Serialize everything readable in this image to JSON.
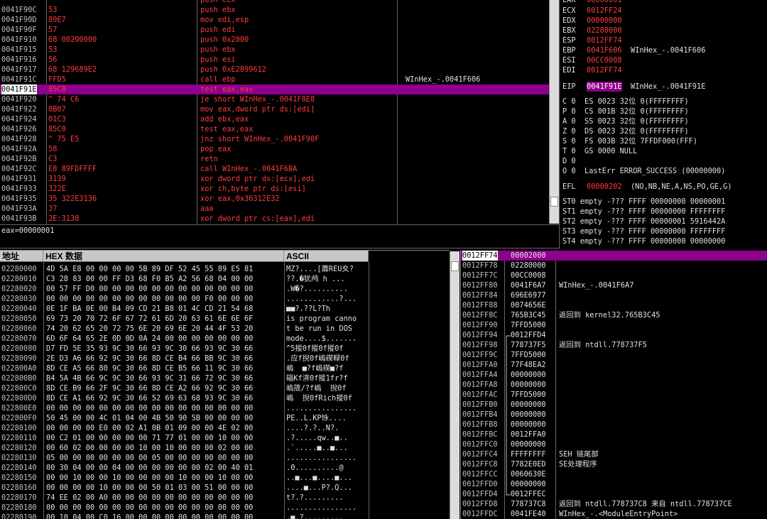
{
  "disasm": {
    "rows": [
      {
        "addr": "0041F90C",
        "bytes": "53",
        "instr": "push ebx",
        "comment": ""
      },
      {
        "addr": "0041F90D",
        "bytes": "89E7",
        "instr": "mov edi,esp",
        "comment": ""
      },
      {
        "addr": "0041F90F",
        "bytes": "57",
        "instr": "push edi",
        "comment": ""
      },
      {
        "addr": "0041F910",
        "bytes": "68 00200000",
        "instr": "push 0x2000",
        "comment": ""
      },
      {
        "addr": "0041F915",
        "bytes": "53",
        "instr": "push ebx",
        "comment": ""
      },
      {
        "addr": "0041F916",
        "bytes": "56",
        "instr": "push esi",
        "comment": ""
      },
      {
        "addr": "0041F917",
        "bytes": "68 129689E2",
        "instr": "push 0xE2899612",
        "comment": ""
      },
      {
        "addr": "0041F91C",
        "bytes": "FFD5",
        "instr": "call ebp",
        "comment": "WInHex_-.0041F606"
      },
      {
        "addr": "0041F91E",
        "bytes": "85C0",
        "instr": "test eax,eax",
        "comment": ""
      },
      {
        "addr": "0041F920",
        "bytes": "^ 74 C6",
        "instr": "je short WInHex_-.0041F8E8",
        "comment": ""
      },
      {
        "addr": "0041F922",
        "bytes": "8B07",
        "instr": "mov eax,dword ptr ds:[edi]",
        "comment": ""
      },
      {
        "addr": "0041F924",
        "bytes": "01C3",
        "instr": "add ebx,eax",
        "comment": ""
      },
      {
        "addr": "0041F926",
        "bytes": "85C0",
        "instr": "test eax,eax",
        "comment": ""
      },
      {
        "addr": "0041F928",
        "bytes": "^ 75 E5",
        "instr": "jnz short WInHex_-.0041F90F",
        "comment": ""
      },
      {
        "addr": "0041F92A",
        "bytes": "58",
        "instr": "pop eax",
        "comment": ""
      },
      {
        "addr": "0041F92B",
        "bytes": "C3",
        "instr": "retn",
        "comment": ""
      },
      {
        "addr": "0041F92C",
        "bytes": "E8 89FDFFFF",
        "instr": "call WInHex_-.0041F6BA",
        "comment": ""
      },
      {
        "addr": "0041F931",
        "bytes": "3139",
        "instr": "xor dword ptr ds:[ecx],edi",
        "comment": ""
      },
      {
        "addr": "0041F933",
        "bytes": "322E",
        "instr": "xor ch,byte ptr ds:[esi]",
        "comment": ""
      },
      {
        "addr": "0041F935",
        "bytes": "35 322E3136",
        "instr": "xor eax,0x36312E32",
        "comment": ""
      },
      {
        "addr": "0041F93A",
        "bytes": "37",
        "instr": "aaa",
        "comment": ""
      },
      {
        "addr": "0041F93B",
        "bytes": "2E:3138",
        "instr": "xor dword ptr cs:[eax],edi",
        "comment": ""
      }
    ],
    "selected_index": 8,
    "info_line": "eax=00000001"
  },
  "registers": {
    "lines": [
      {
        "name": "ECX",
        "value": "0012FF24",
        "note": ""
      },
      {
        "name": "EDX",
        "value": "00000000",
        "note": ""
      },
      {
        "name": "EBX",
        "value": "02280000",
        "note": ""
      },
      {
        "name": "ESP",
        "value": "0012FF74",
        "note": ""
      },
      {
        "name": "EBP",
        "value": "0041F606",
        "note": "WInHex_-.0041F606"
      },
      {
        "name": "ESI",
        "value": "00CC0008",
        "note": ""
      },
      {
        "name": "EDI",
        "value": "0012FF74",
        "note": ""
      }
    ],
    "eip": {
      "name": "EIP",
      "value": "0041F91E",
      "note": "WInHex_-.0041F91E"
    },
    "flags": [
      "C 0  ES 0023 32位 0(FFFFFFFF)",
      "P 0  CS 001B 32位 0(FFFFFFFF)",
      "A 0  SS 0023 32位 0(FFFFFFFF)",
      "Z 0  DS 0023 32位 0(FFFFFFFF)",
      "S 0  FS 003B 32位 7FFDF000(FFF)",
      "T 0  GS 0000 NULL",
      "D 0",
      "O 0  LastErr ERROR_SUCCESS (00000000)"
    ],
    "efl": {
      "name": "EFL",
      "value": "00000202",
      "note": "(NO,NB,NE,A,NS,PO,GE,G)"
    },
    "fpu": [
      "ST0 empty -??? FFFF 00000000 00000001",
      "ST1 empty -??? FFFF 00000000 FFFFFFFF",
      "ST2 empty -??? FFFF 00000001 5916442A",
      "ST3 empty -??? FFFF 00000000 FFFFFFFF",
      "ST4 empty -??? FFFF 00000000 00000000"
    ]
  },
  "dump": {
    "headers": {
      "address": "地址",
      "hex": "HEX 数据",
      "ascii": "ASCII"
    },
    "rows": [
      {
        "addr": "02280000",
        "hex": "4D 5A E8 00 00 00 00 5B 89 DF 52 45 55 89 E5 81",
        "ascii": "MZ?....[蕭REU夊?"
      },
      {
        "addr": "02280010",
        "hex": "C3 28 83 00 00 FF D3 68 F0 B5 A2 56 68 04 00 00",
        "ascii": "??.�犹鸬 h ..."
      },
      {
        "addr": "02280020",
        "hex": "00 57 FF D0 00 00 00 00 00 00 00 00 00 00 00 00",
        "ascii": ".W�?.........."
      },
      {
        "addr": "02280030",
        "hex": "00 00 00 00 00 00 00 00 00 00 00 00 F0 00 00 00",
        "ascii": "............?..."
      },
      {
        "addr": "02280040",
        "hex": "0E 1F BA 0E 00 B4 09 CD 21 B8 01 4C CD 21 54 68",
        "ascii": "■■?.??L?Th"
      },
      {
        "addr": "02280050",
        "hex": "69 73 20 70 72 6F 67 72 61 6D 20 63 61 6E 6E 6F",
        "ascii": "is program canno"
      },
      {
        "addr": "02280060",
        "hex": "74 20 62 65 20 72 75 6E 20 69 6E 20 44 4F 53 20",
        "ascii": "t be run in DOS "
      },
      {
        "addr": "02280070",
        "hex": "6D 6F 64 65 2E 0D 0D 0A 24 00 00 00 00 00 00 00",
        "ascii": "mode....$......."
      },
      {
        "addr": "02280080",
        "hex": "D7 FD 5E 35 93 9C 30 66 93 9C 30 66 93 9C 30 66",
        "ascii": "^5摐0f摐0f摐0f"
      },
      {
        "addr": "02280090",
        "hex": "2E D3 A6 66 92 9C 30 66 8D CE B4 66 BB 9C 30 66",
        "ascii": ".应f掜0f嵨碶粶0f"
      },
      {
        "addr": "022800A0",
        "hex": "8D CE A5 66 80 9C 30 66 8D CE B5 66 11 9C 30 66",
        "ascii": "嵨  ■?f嵨碶■?f"
      },
      {
        "addr": "022800B0",
        "hex": "B4 5A 4B 66 9C 9C 30 66 93 9C 31 66 72 9C 30 66",
        "ascii": "碯Kf渀0f摐1fr?f"
      },
      {
        "addr": "022800C0",
        "hex": "8D CE B9 66 2F 9C 30 66 8D CE A2 66 92 9C 30 66",
        "ascii": "嵨筬/?f嵨  掜0f"
      },
      {
        "addr": "022800D0",
        "hex": "8D CE A1 66 92 9C 30 66 52 69 63 68 93 9C 30 66",
        "ascii": "嵨  掜0fRich摐0f"
      },
      {
        "addr": "022800E0",
        "hex": "00 00 00 00 00 00 00 00 00 00 00 00 00 00 00 00",
        "ascii": "................"
      },
      {
        "addr": "022800F0",
        "hex": "50 45 00 00 4C 01 04 00 4B 50 90 5B 00 00 00 00",
        "ascii": "PE..L.KP怺...."
      },
      {
        "addr": "02280100",
        "hex": "00 00 00 00 E0 00 02 A1 0B 01 09 00 00 4E 02 00",
        "ascii": "....?.?..N?."
      },
      {
        "addr": "02280110",
        "hex": "00 C2 01 00 00 00 00 00 71 77 01 00 00 10 00 00",
        "ascii": ".?.....qw..■.."
      },
      {
        "addr": "02280120",
        "hex": "00 60 02 00 00 00 00 10 00 10 00 00 00 02 00 00",
        "ascii": ".`.....■..■..."
      },
      {
        "addr": "02280130",
        "hex": "05 00 00 00 00 00 00 00 05 00 00 00 00 00 00 00",
        "ascii": "................"
      },
      {
        "addr": "02280140",
        "hex": "00 30 04 00 00 04 00 00 00 00 00 00 02 00 40 01",
        "ascii": ".0..........@"
      },
      {
        "addr": "02280150",
        "hex": "00 00 10 00 00 10 00 00 00 00 10 00 00 10 00 00",
        "ascii": "..■...■....■..."
      },
      {
        "addr": "02280160",
        "hex": "00 00 00 00 10 00 00 00 50 01 03 00 51 00 00 00",
        "ascii": "....■...P?.Q..."
      },
      {
        "addr": "02280170",
        "hex": "74 EE 02 00 A0 00 00 00 00 00 00 00 00 00 00 00",
        "ascii": "t?.?........."
      },
      {
        "addr": "02280180",
        "hex": "00 00 00 00 00 00 00 00 00 00 00 00 00 00 00 00",
        "ascii": "................"
      },
      {
        "addr": "02280190",
        "hex": "00 10 04 00 C0 16 00 00 00 00 00 00 00 00 00 00",
        "ascii": ".■.?........."
      }
    ]
  },
  "stack": {
    "rows": [
      {
        "addr": "0012FF74",
        "val": "00002000",
        "comment": ""
      },
      {
        "addr": "0012FF78",
        "val": "02280000",
        "comment": ""
      },
      {
        "addr": "0012FF7C",
        "val": "00CC0008",
        "comment": ""
      },
      {
        "addr": "0012FF80",
        "val": "0041F6A7",
        "comment": "WInHex_-.0041F6A7"
      },
      {
        "addr": "0012FF84",
        "val": "696E6977",
        "comment": ""
      },
      {
        "addr": "0012FF88",
        "val": "0074656E",
        "comment": ""
      },
      {
        "addr": "0012FF8C",
        "val": "765B3C45",
        "comment": "返回到 kernel32.765B3C45"
      },
      {
        "addr": "0012FF90",
        "val": "7FFD5000",
        "comment": ""
      },
      {
        "addr": "0012FF94",
        "val": "0012FFD4",
        "comment": ""
      },
      {
        "addr": "0012FF98",
        "val": "778737F5",
        "comment": "返回到 ntdll.778737F5"
      },
      {
        "addr": "0012FF9C",
        "val": "7FFD5000",
        "comment": ""
      },
      {
        "addr": "0012FFA0",
        "val": "77F48EA2",
        "comment": ""
      },
      {
        "addr": "0012FFA4",
        "val": "00000000",
        "comment": ""
      },
      {
        "addr": "0012FFA8",
        "val": "00000000",
        "comment": ""
      },
      {
        "addr": "0012FFAC",
        "val": "7FFD5000",
        "comment": ""
      },
      {
        "addr": "0012FFB0",
        "val": "00000000",
        "comment": ""
      },
      {
        "addr": "0012FFB4",
        "val": "00000000",
        "comment": ""
      },
      {
        "addr": "0012FFB8",
        "val": "00000000",
        "comment": ""
      },
      {
        "addr": "0012FFBC",
        "val": "0012FFA0",
        "comment": ""
      },
      {
        "addr": "0012FFC0",
        "val": "00000000",
        "comment": ""
      },
      {
        "addr": "0012FFC4",
        "val": "FFFFFFFF",
        "comment": "SEH 链尾部"
      },
      {
        "addr": "0012FFC8",
        "val": "7782E0ED",
        "comment": "SE处理程序"
      },
      {
        "addr": "0012FFCC",
        "val": "0060630E",
        "comment": ""
      },
      {
        "addr": "0012FFD0",
        "val": "00000000",
        "comment": ""
      },
      {
        "addr": "0012FFD4",
        "val": "0012FFEC",
        "comment": ""
      },
      {
        "addr": "0012FFD8",
        "val": "778737C8",
        "comment": "返回到 ntdll.778737C8 来自 ntdll.778737CE"
      },
      {
        "addr": "0012FFDC",
        "val": "0041FE40",
        "comment": "WInHex_-.<ModuleEntryPoint>"
      }
    ]
  }
}
